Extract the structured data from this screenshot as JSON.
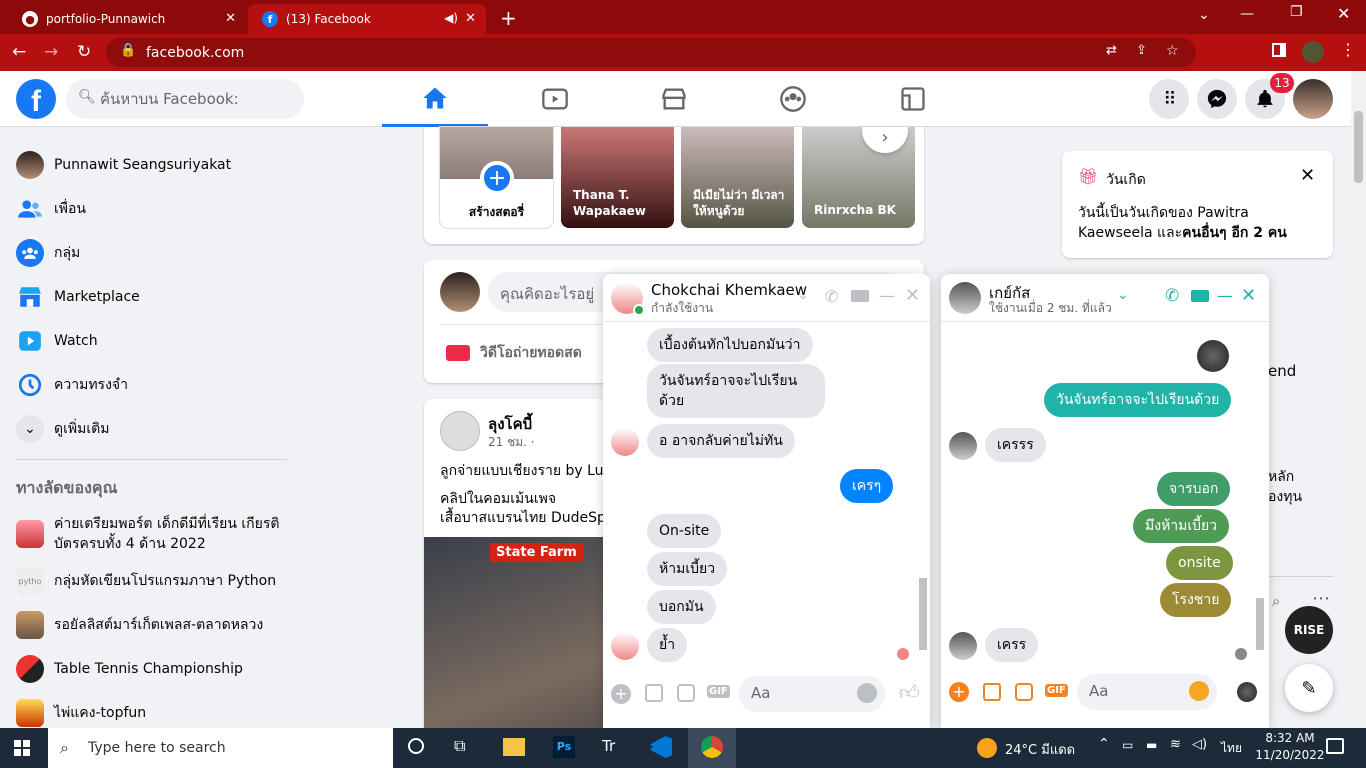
{
  "browser": {
    "tabs": [
      {
        "title": "portfolio-Punnawich"
      },
      {
        "title": "(13) Facebook"
      }
    ],
    "url": "facebook.com"
  },
  "fb_header": {
    "search_placeholder": "ค้นหาบน Facebook:",
    "notification_count": "13"
  },
  "sidebar": {
    "items": [
      {
        "label": "Punnawit Seangsuriyakat",
        "icon": "profile-avatar"
      },
      {
        "label": "เพื่อน",
        "icon": "friends-icon"
      },
      {
        "label": "กลุ่ม",
        "icon": "groups-icon"
      },
      {
        "label": "Marketplace",
        "icon": "marketplace-icon"
      },
      {
        "label": "Watch",
        "icon": "watch-icon"
      },
      {
        "label": "ความทรงจำ",
        "icon": "memories-icon"
      },
      {
        "label": "ดูเพิ่มเติม",
        "icon": "chevron-down-icon"
      }
    ],
    "shortcuts_title": "ทางลัดของคุณ",
    "shortcuts": [
      {
        "label": "ค่ายเตรียมพอร์ต เด็กดีมีที่เรียน เกียรติบัตรครบทั้ง 4 ด้าน 2022"
      },
      {
        "label": "กลุ่มหัดเขียนโปรแกรมภาษา Python"
      },
      {
        "label": "รอยัลลิสต์มาร์เก็ตเพลส-ตลาดหลวง"
      },
      {
        "label": "Table Tennis Championship"
      },
      {
        "label": "ไพ่แคง-topfun"
      }
    ]
  },
  "stories": [
    {
      "label": "สร้างสตอรี่"
    },
    {
      "label": "Thana T. Wapakaew"
    },
    {
      "label": "มีเมียไม่ว่า มีเวลาให้หนูด้วย"
    },
    {
      "label": "Rinrxcha BK"
    }
  ],
  "composer": {
    "placeholder": "คุณคิดอะไรอยู่",
    "live_label": "วิดีโอถ่ายทอดสด"
  },
  "post": {
    "author": "ลุงโคบี้",
    "time": "21 ชม. ·",
    "line1": "ลูกจ่ายแบบเชียงราย by Lu",
    "line2": "คลิปในคอมเม้นเพจ",
    "line3": "เสื้อบาสแบรนไทย DudeSp",
    "banner": "State Farm"
  },
  "birthday": {
    "title": "วันเกิด",
    "text_prefix": "วันนี้เป็นวันเกิดของ Pawitra Kaewseela และ",
    "text_bold": "คนอื่นๆ อีก 2 คน"
  },
  "right_partial": {
    "t1": "end",
    "t2": "หลัก",
    "t3": "องทุน"
  },
  "chat1": {
    "name": "Chokchai Khemkaew",
    "status": "กำลังใช้งาน",
    "messages": [
      {
        "text": "เบื้องต้นทักไปบอกมันว่า",
        "dir": "in"
      },
      {
        "text": "วันจันทร์อาจจะไปเรียนด้วย",
        "dir": "in"
      },
      {
        "text": "อ อาจกลับค่ายไม่ทัน",
        "dir": "in"
      },
      {
        "text": "เครๆ",
        "dir": "out"
      },
      {
        "text": "On-site",
        "dir": "in"
      },
      {
        "text": "ห้ามเบี้ยว",
        "dir": "in"
      },
      {
        "text": "บอกมัน",
        "dir": "in"
      },
      {
        "text": "ย้ำ",
        "dir": "in"
      }
    ],
    "input_placeholder": "Aa",
    "accent": "#0084ff"
  },
  "chat2": {
    "name": "เกย์กัส",
    "status": "ใช้งานเมื่อ 2 ชม. ที่แล้ว",
    "messages": [
      {
        "text": "วันจันทร์อาจจะไปเรียนด้วย",
        "dir": "out"
      },
      {
        "text": "เครรร",
        "dir": "in"
      },
      {
        "text": "จารบอก",
        "dir": "out"
      },
      {
        "text": "มึงห้ามเบี้ยว",
        "dir": "out"
      },
      {
        "text": "onsite",
        "dir": "out"
      },
      {
        "text": "โรงชาย",
        "dir": "out"
      },
      {
        "text": "เครร",
        "dir": "in"
      }
    ],
    "input_placeholder": "Aa",
    "accent": "#20b3a8"
  },
  "rise_label": "RISE",
  "taskbar": {
    "search": "Type here to search",
    "weather": "24°C มีแดด",
    "lang": "ไทย",
    "time": "8:32 AM",
    "date": "11/20/2022"
  }
}
